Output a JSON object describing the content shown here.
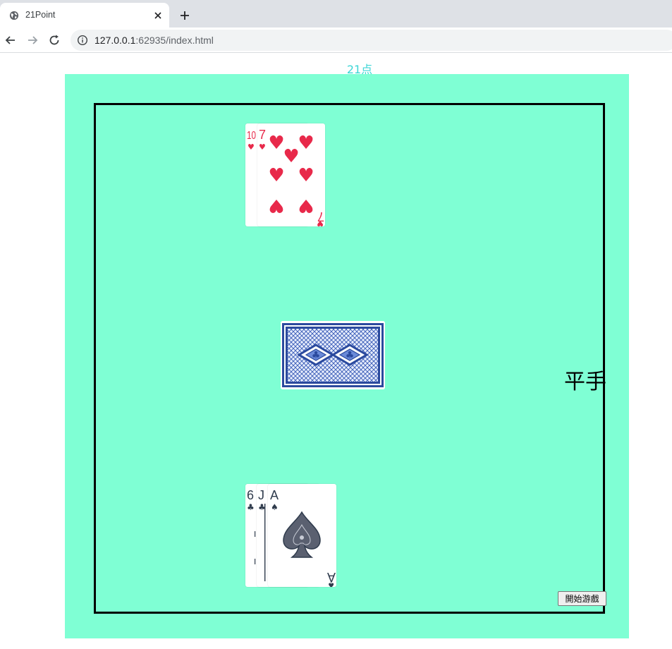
{
  "browser": {
    "tab_title": "21Point",
    "url_host": "127.0.0.1",
    "url_rest": ":62935/index.html"
  },
  "page": {
    "heading": "21点",
    "result_text": "平手",
    "start_button_label": "開始游戲"
  },
  "dealer_hand": [
    {
      "rank": "10",
      "suit": "hearts",
      "suit_symbol": "♥",
      "color": "#e8294a"
    },
    {
      "rank": "7",
      "suit": "hearts",
      "suit_symbol": "♥",
      "color": "#e8294a",
      "corner_bottom": "7"
    }
  ],
  "player_hand": [
    {
      "rank": "6",
      "suit": "clubs",
      "suit_symbol": "♣",
      "color": "#2f3b4c"
    },
    {
      "rank": "J",
      "suit": "clubs",
      "suit_symbol": "♣",
      "color": "#2f3b4c"
    },
    {
      "rank": "A",
      "suit": "spades",
      "suit_symbol": "♠",
      "color": "#2f3b4c",
      "corner_bottom": "A"
    }
  ],
  "deck": {
    "back_color": "#2b4a9e"
  },
  "colors": {
    "stage_bg": "#7fffd4",
    "heading": "#3ed6d6",
    "heart_red": "#e8294a",
    "ink": "#2f3b4c"
  }
}
